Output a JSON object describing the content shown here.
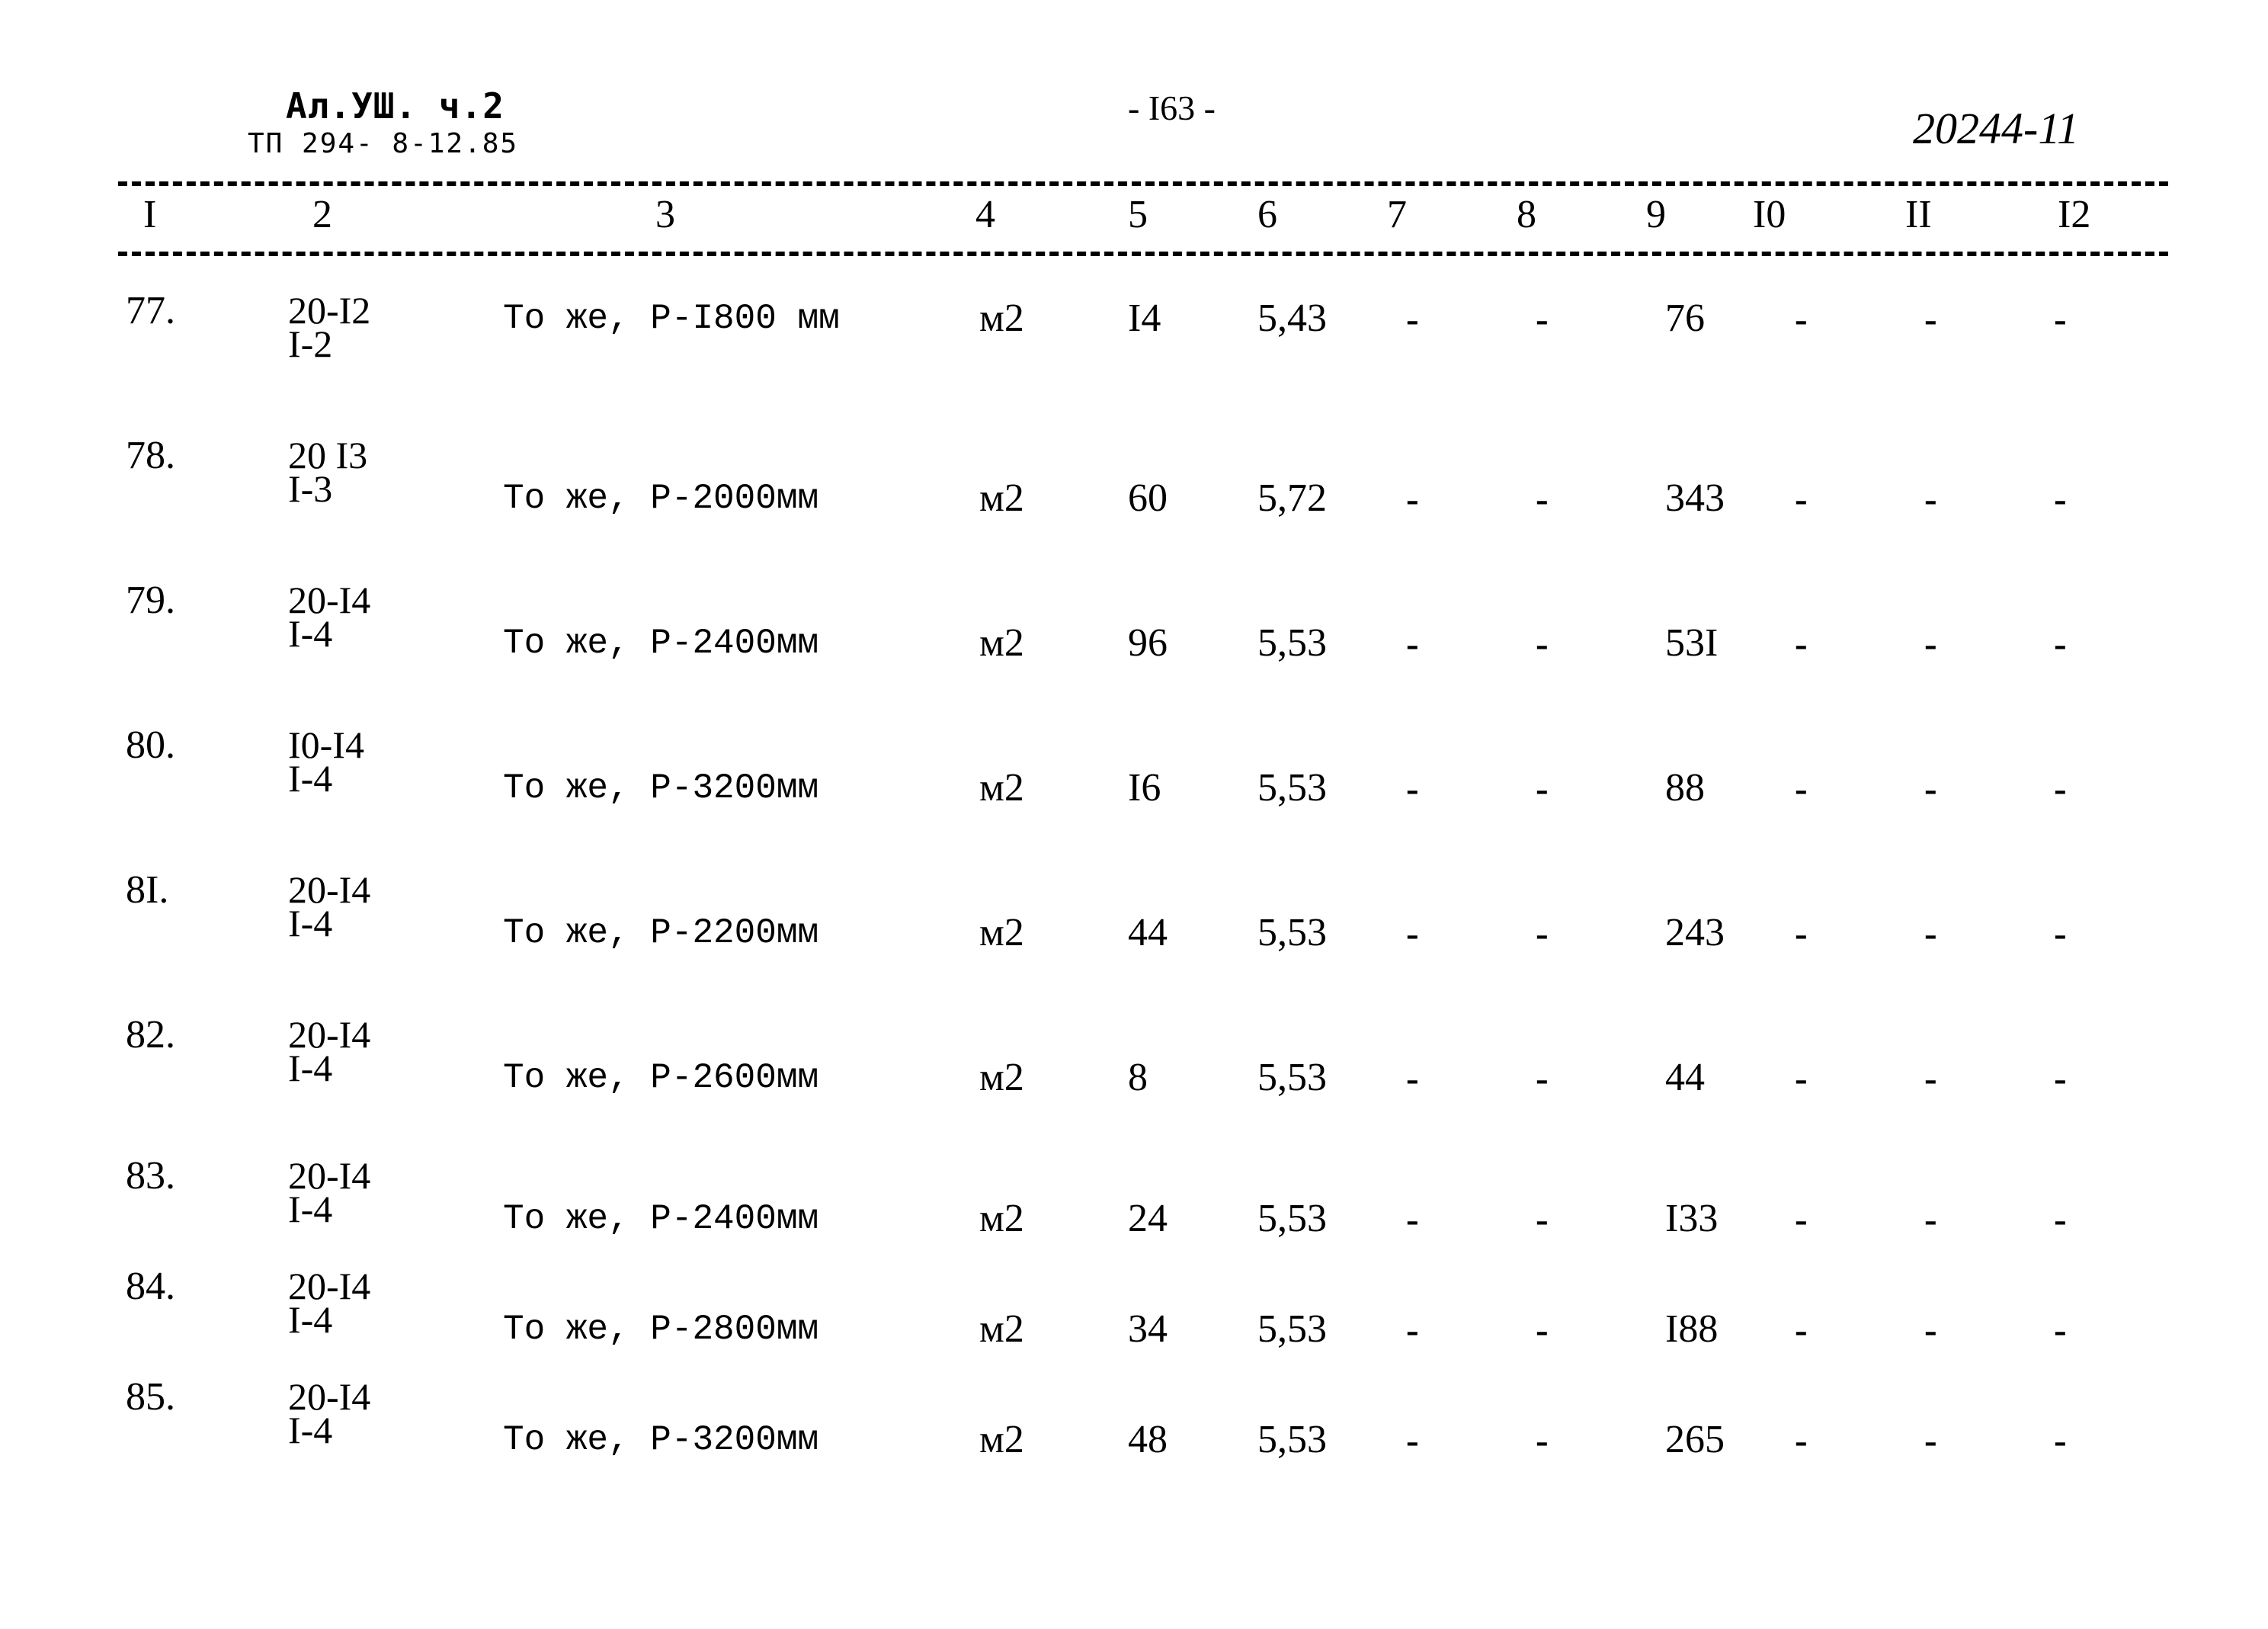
{
  "header": {
    "series": "Ал.УШ.  ч.2",
    "project": "ТП 294- 8-12.85",
    "page_number": "- I63  -",
    "doc_code": "20244-11"
  },
  "table": {
    "columns": [
      "I",
      "2",
      "3",
      "4",
      "5",
      "6",
      "7",
      "8",
      "9",
      "I0",
      "II",
      "I2"
    ],
    "rows": [
      {
        "no": "77.",
        "code_line1": "20-I2",
        "code_line2": "I-2",
        "description": "То же, Р-I800 мм",
        "unit": "м2",
        "qty": "I4",
        "price": "5,43",
        "c7": "-",
        "c8": "-",
        "c9": "76",
        "c10": "-",
        "c11": "-",
        "c12": "-"
      },
      {
        "no": "78.",
        "code_line1": "20 I3",
        "code_line2": "I-3",
        "description": "То же, Р-2000мм",
        "unit": "м2",
        "qty": "60",
        "price": "5,72",
        "c7": "-",
        "c8": "-",
        "c9": "343",
        "c10": "-",
        "c11": "-",
        "c12": "-"
      },
      {
        "no": "79.",
        "code_line1": "20-I4",
        "code_line2": "I-4",
        "description": "То же, Р-2400мм",
        "unit": "м2",
        "qty": "96",
        "price": "5,53",
        "c7": "-",
        "c8": "-",
        "c9": "53I",
        "c10": "-",
        "c11": "-",
        "c12": "-"
      },
      {
        "no": "80.",
        "code_line1": "I0-I4",
        "code_line2": "I-4",
        "description": "То же, Р-3200мм",
        "unit": "м2",
        "qty": "I6",
        "price": "5,53",
        "c7": "-",
        "c8": "-",
        "c9": "88",
        "c10": "-",
        "c11": "-",
        "c12": "-"
      },
      {
        "no": "8I.",
        "code_line1": "20-I4",
        "code_line2": "I-4",
        "description": "То же, Р-2200мм",
        "unit": "м2",
        "qty": "44",
        "price": "5,53",
        "c7": "-",
        "c8": "-",
        "c9": "243",
        "c10": "-",
        "c11": "-",
        "c12": "-"
      },
      {
        "no": "82.",
        "code_line1": "20-I4",
        "code_line2": "I-4",
        "description": "То же, Р-2600мм",
        "unit": "м2",
        "qty": "8",
        "price": "5,53",
        "c7": "-",
        "c8": "-",
        "c9": "44",
        "c10": "-",
        "c11": "-",
        "c12": "-"
      },
      {
        "no": "83.",
        "code_line1": "20-I4",
        "code_line2": "I-4",
        "description": "То же, Р-2400мм",
        "unit": "м2",
        "qty": "24",
        "price": "5,53",
        "c7": "-",
        "c8": "-",
        "c9": "I33",
        "c10": "-",
        "c11": "-",
        "c12": "-"
      },
      {
        "no": "84.",
        "code_line1": "20-I4",
        "code_line2": "I-4",
        "description": "То же, Р-2800мм",
        "unit": "м2",
        "qty": "34",
        "price": "5,53",
        "c7": "-",
        "c8": "-",
        "c9": "I88",
        "c10": "-",
        "c11": "-",
        "c12": "-"
      },
      {
        "no": "85.",
        "code_line1": "20-I4",
        "code_line2": "I-4",
        "description": "То же, Р-3200мм",
        "unit": "м2",
        "qty": "48",
        "price": "5,53",
        "c7": "-",
        "c8": "-",
        "c9": "265",
        "c10": "-",
        "c11": "-",
        "c12": "-"
      }
    ]
  }
}
